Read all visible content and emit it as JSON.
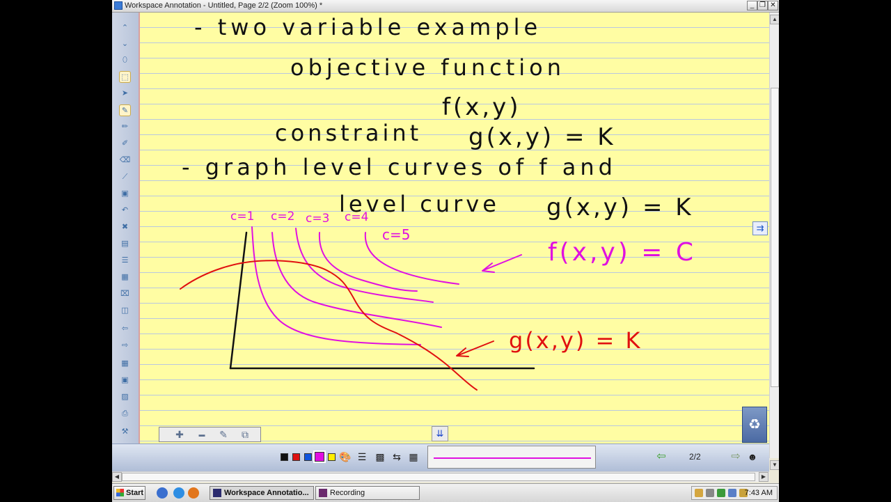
{
  "window": {
    "title": "Workspace Annotation - Untitled, Page 2/2  (Zoom 100%) *",
    "minimize": "_",
    "restore": "❐",
    "close": "✕"
  },
  "notes": {
    "line1": "- two variable example",
    "line2": "objective function",
    "line3": "f(x,y)",
    "line4_label": "constraint",
    "line4_eq": "g(x,y) = K",
    "line5": "- graph level curves of f and",
    "line6_label": "level curve",
    "line6_eq": "g(x,y) = K",
    "c1": "c=1",
    "c2": "c=2",
    "c3": "c=3",
    "c4": "c=4",
    "c5": "c=5",
    "f_label": "f(x,y) = C",
    "g_label": "g(x,y) = K"
  },
  "colors": {
    "ink_black": "#111111",
    "ink_magenta": "#e010e0",
    "ink_red": "#e01010",
    "paper": "#fffda3"
  },
  "palette": [
    "#111111",
    "#dd1111",
    "#1155dd",
    "#e010e0",
    "#ffee00"
  ],
  "pager": {
    "page": "2/2"
  },
  "taskbar": {
    "start": "Start",
    "task1": "Workspace Annotatio...",
    "task2": "Recording",
    "clock": "7:43 AM"
  },
  "icons": {
    "side": "⇉",
    "down": "⇊",
    "zoom_in": "✚",
    "zoom_out": "▬",
    "edit": "✎",
    "copy": "⧉"
  }
}
